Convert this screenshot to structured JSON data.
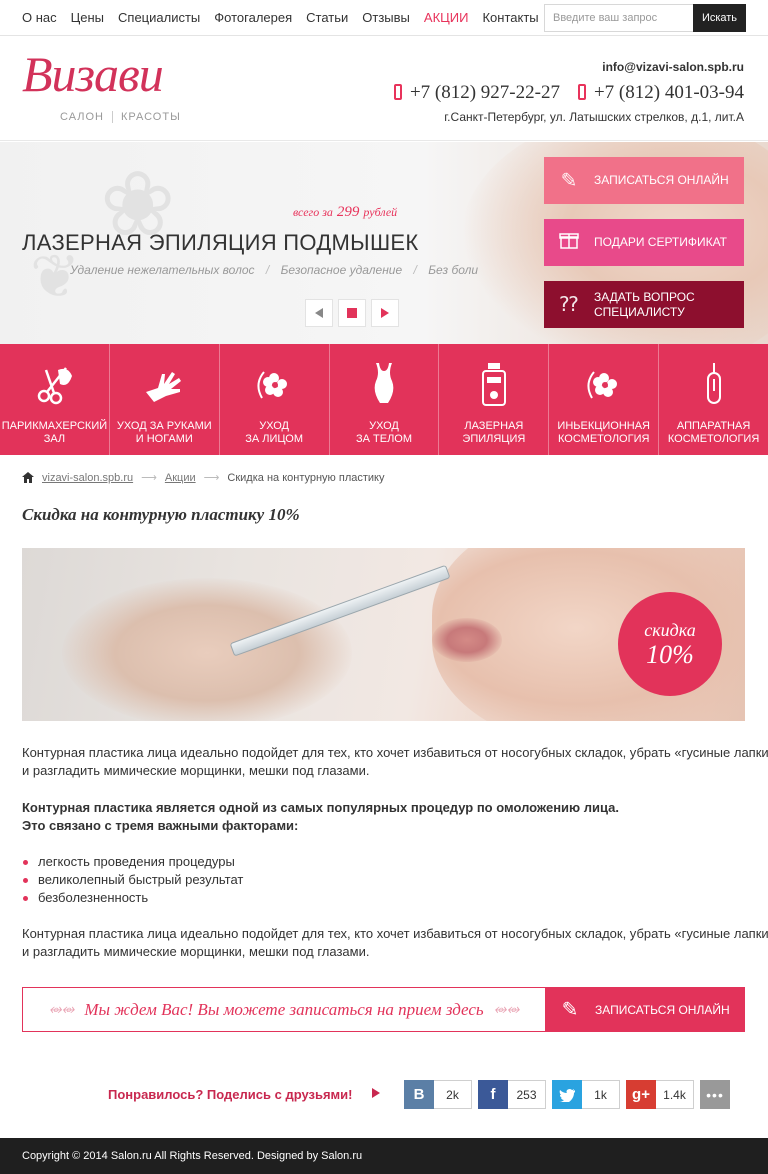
{
  "nav": {
    "items": [
      "О нас",
      "Цены",
      "Специалисты",
      "Фотогалерея",
      "Статьи",
      "Отзывы",
      "АКЦИИ",
      "Контакты"
    ],
    "search_placeholder": "Введите ваш запрос",
    "search_button": "Искать"
  },
  "header": {
    "logo_script": "Визави",
    "logo_sub1": "САЛОН",
    "logo_sub2": "КРАСОТЫ",
    "email": "info@vizavi-salon.spb.ru",
    "phone1": "+7 (812) 927-22-27",
    "phone2": "+7 (812) 401-03-94",
    "address": "г.Санкт-Петербург, ул. Латышских стрелков,  д.1, лит.А"
  },
  "hero": {
    "price_prefix": "всего за",
    "price_value": "299",
    "price_suffix": "рублей",
    "title": "ЛАЗЕРНАЯ ЭПИЛЯЦИЯ ПОДМЫШЕК",
    "sub1": "Удаление нежелательных волос",
    "sub2": "Безопасное удаление",
    "sub3": "Без боли",
    "btn_book": "ЗАПИСАТЬСЯ ОНЛАЙН",
    "btn_gift": "ПОДАРИ СЕРТИФИКАТ",
    "btn_ask_line1": "ЗАДАТЬ ВОПРОС",
    "btn_ask_line2": "СПЕЦИАЛИСТУ"
  },
  "services": [
    {
      "line1": "ПАРИКМАХЕРСКИЙ",
      "line2": "ЗАЛ",
      "icon": "scissors-icon"
    },
    {
      "line1": "УХОД ЗА РУКАМИ",
      "line2": "И НОГАМИ",
      "icon": "hands-icon"
    },
    {
      "line1": "УХОД",
      "line2": "ЗА ЛИЦОМ",
      "icon": "face-flower-icon"
    },
    {
      "line1": "УХОД",
      "line2": "ЗА ТЕЛОМ",
      "icon": "body-icon"
    },
    {
      "line1": "ЛАЗЕРНАЯ",
      "line2": "ЭПИЛЯЦИЯ",
      "icon": "laser-device-icon"
    },
    {
      "line1": "ИНЬЕКЦИОННАЯ",
      "line2": "КОСМЕТОЛОГИЯ",
      "icon": "face-flower-icon"
    },
    {
      "line1": "АППАРАТНАЯ",
      "line2": "КОСМЕТОЛОГИЯ",
      "icon": "apparatus-icon"
    }
  ],
  "breadcrumb": {
    "home": "vizavi-salon.spb.ru",
    "section": "Акции",
    "current": "Скидка на контурную пластику"
  },
  "page": {
    "title": "Скидка на контурную пластику 10%",
    "badge_line1": "скидка",
    "badge_line2": "10%",
    "p1_line1": "Контурная пластика лица идеально подойдет для тех, кто хочет избавиться от носогубных складок, убрать «гусиные лапки»",
    "p1_line2": "и разгладить мимические морщинки, мешки под глазами.",
    "p2_line1": "Контурная пластика является одной из самых популярных процедур по омоложению лица.",
    "p2_line2": "Это связано с тремя важными факторами:",
    "bullets": [
      "легкость проведения процедуры",
      "великолепный быстрый результат",
      "безболезненность"
    ],
    "p3_line1": "Контурная пластика лица идеально подойдет для тех, кто хочет избавиться от носогубных складок, убрать «гусиные лапки»",
    "p3_line2": "и разгладить мимические морщинки, мешки под глазами."
  },
  "cta": {
    "message": "Мы ждем Вас! Вы можете записаться на прием здесь",
    "button": "ЗАПИСАТЬСЯ ОНЛАЙН"
  },
  "share": {
    "label": "Понравилось? Поделись с друзьями!",
    "vk_count": "2k",
    "fb_count": "253",
    "tw_count": "1k",
    "gp_count": "1.4k",
    "more": "•••"
  },
  "footer": {
    "text": "Copyright © 2014 Salon.ru All Rights Reserved. Designed by Salon.ru"
  },
  "colors": {
    "accent": "#e2335a",
    "dark_accent": "#8d0f2e",
    "pink_button": "#f17189"
  }
}
